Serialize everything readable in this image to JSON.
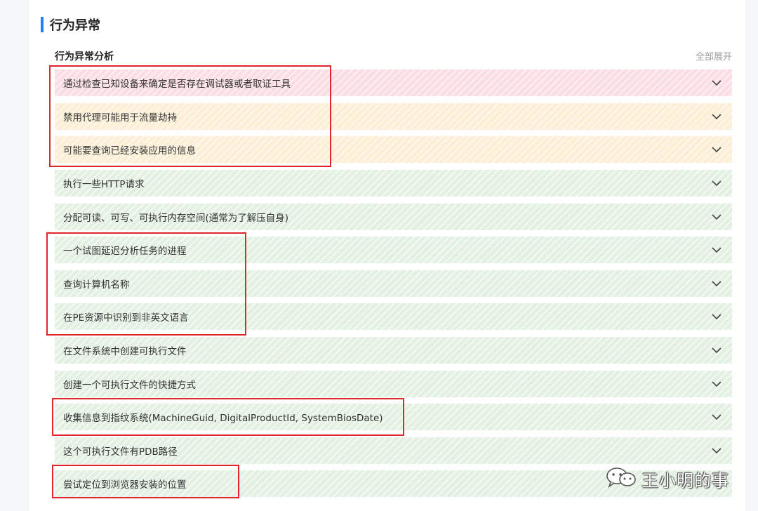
{
  "section": {
    "title": "行为异常"
  },
  "analysis": {
    "title": "行为异常分析",
    "expand_all_label": "全部展开"
  },
  "items": [
    {
      "label": "通过检查已知设备来确定是否存在调试器或者取证工具",
      "severity": "high"
    },
    {
      "label": "禁用代理可能用于流量劫持",
      "severity": "mid"
    },
    {
      "label": "可能要查询已经安装应用的信息",
      "severity": "mid"
    },
    {
      "label": "执行一些HTTP请求",
      "severity": "low"
    },
    {
      "label": "分配可读、可写、可执行内存空间(通常为了解压自身)",
      "severity": "low"
    },
    {
      "label": "一个试图延迟分析任务的进程",
      "severity": "low"
    },
    {
      "label": "查询计算机名称",
      "severity": "low"
    },
    {
      "label": "在PE资源中识别到非英文语言",
      "severity": "low"
    },
    {
      "label": "在文件系统中创建可执行文件",
      "severity": "low"
    },
    {
      "label": "创建一个可执行文件的快捷方式",
      "severity": "low"
    },
    {
      "label": "收集信息到指纹系统(MachineGuid, DigitalProductId, SystemBiosDate)",
      "severity": "low"
    },
    {
      "label": "这个可执行文件有PDB路径",
      "severity": "low"
    },
    {
      "label": "尝试定位到浏览器安装的位置",
      "severity": "low"
    }
  ],
  "watermark": {
    "text": "王小明的事",
    "icon": "wechat-icon"
  },
  "colors": {
    "accent": "#1e80ff",
    "severity_high": "#fbdde4",
    "severity_mid": "#fcefd6",
    "severity_low": "#e3f1e3",
    "highlight_border": "#e0262b"
  }
}
